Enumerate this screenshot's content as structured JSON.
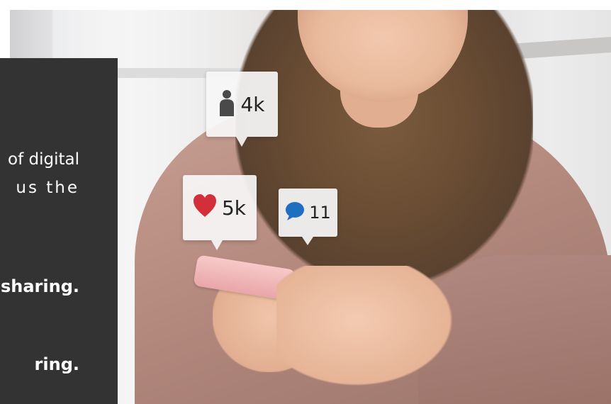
{
  "panel": {
    "line1": "of digital",
    "line2": "us the",
    "line3": "sharing.",
    "line4": "ring."
  },
  "notifications": {
    "followers": {
      "icon": "person-icon",
      "count": "4k",
      "color": "#4a4a4a"
    },
    "likes": {
      "icon": "heart-icon",
      "count": "5k",
      "color": "#d32f3a"
    },
    "comments": {
      "icon": "speech-bubble-icon",
      "count": "11",
      "color": "#1f6fc0"
    }
  }
}
